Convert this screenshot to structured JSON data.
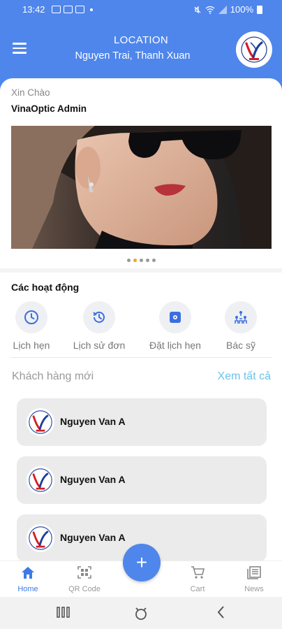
{
  "status_bar": {
    "time": "13:42",
    "battery": "100%"
  },
  "header": {
    "location_title": "LOCATION",
    "location_value": "Nguyen Trai, Thanh Xuan"
  },
  "greeting": {
    "hello": "Xin Chào",
    "user_name": "VinaOptic Admin"
  },
  "carousel": {
    "dot_count": 5,
    "active_index": 1
  },
  "activities": {
    "title": "Các hoạt động",
    "items": [
      {
        "label": "Lịch hẹn",
        "icon": "clock-icon"
      },
      {
        "label": "Lịch sử đơn",
        "icon": "history-icon"
      },
      {
        "label": "Đặt lịch hẹn",
        "icon": "schedule-gear-icon"
      },
      {
        "label": "Bác sỹ",
        "icon": "doctors-icon"
      }
    ]
  },
  "customers": {
    "title": "Khách hàng mới",
    "see_all": "Xem tất cả",
    "items": [
      {
        "name": "Nguyen Van A"
      },
      {
        "name": "Nguyen Van A"
      },
      {
        "name": "Nguyen Van A"
      }
    ]
  },
  "bottom_nav": {
    "items": [
      {
        "label": "Home",
        "icon": "home-icon",
        "active": true
      },
      {
        "label": "QR Code",
        "icon": "qr-code-icon",
        "active": false
      },
      {
        "label": "Cart",
        "icon": "cart-icon",
        "active": false
      },
      {
        "label": "News",
        "icon": "news-icon",
        "active": false
      }
    ],
    "fab_label": "+"
  },
  "colors": {
    "primary": "#4f86ec",
    "accent_link": "#6cc3e8",
    "active_dot": "#f0a32c"
  }
}
